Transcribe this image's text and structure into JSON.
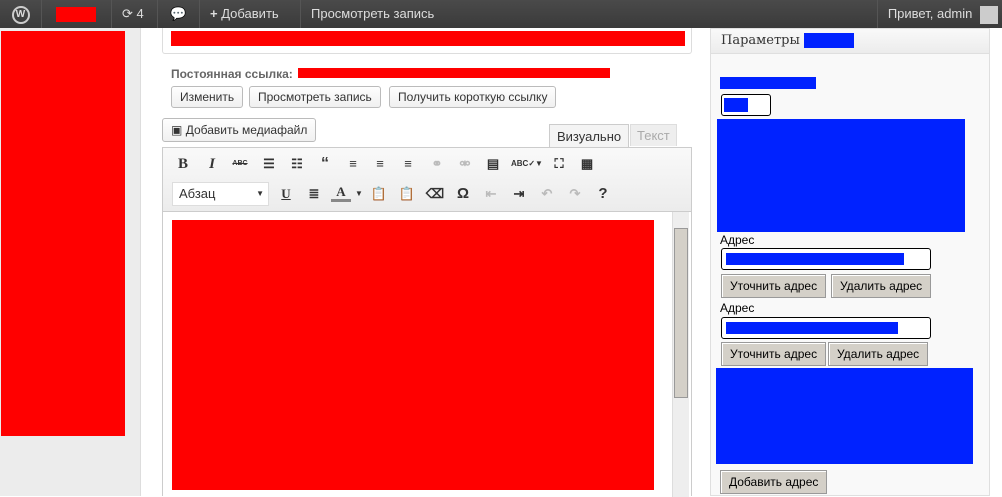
{
  "adminbar": {
    "updates_count": "4",
    "add_label": "Добавить",
    "view_post": "Просмотреть запись",
    "greeting": "Привет, admin"
  },
  "permalink": {
    "label": "Постоянная ссылка:",
    "edit_button": "Изменить",
    "view_button": "Просмотреть запись",
    "shortlink_button": "Получить короткую ссылку"
  },
  "editor": {
    "add_media": "Добавить медиафайл",
    "tab_visual": "Визуально",
    "tab_text": "Текст",
    "format_select": "Абзац"
  },
  "metabox": {
    "title": "Параметры",
    "fields": [
      {
        "label": "Адрес",
        "refine": "Уточнить адрес",
        "delete": "Удалить адрес"
      },
      {
        "label": "Адрес",
        "refine": "Уточнить адрес",
        "delete": "Удалить адрес"
      }
    ],
    "add_address": "Добавить адрес"
  },
  "colors": {
    "adminbar": "#464646",
    "redaction_red": "#ff0000",
    "redaction_blue": "#0022ff"
  }
}
